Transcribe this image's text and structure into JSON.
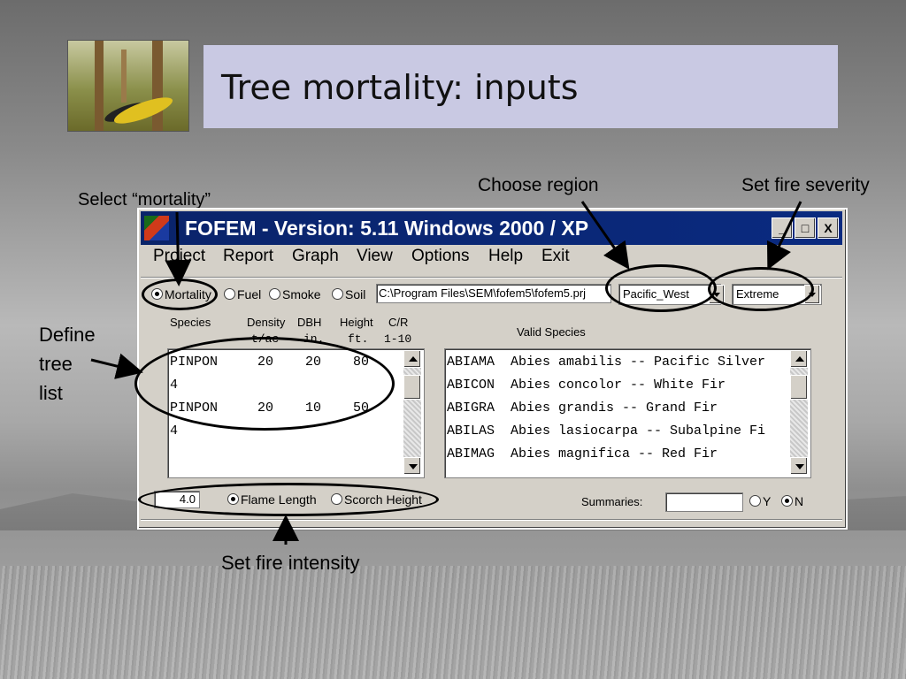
{
  "slide": {
    "title": "Tree mortality: inputs",
    "annotations": {
      "select_mortality": "Select “mortality”",
      "choose_region": "Choose region",
      "set_fire_severity": "Set fire severity",
      "define_tree_list": [
        "Define",
        "tree",
        "list"
      ],
      "set_fire_intensity": "Set fire intensity"
    }
  },
  "window": {
    "title": "FOFEM  - Version: 5.11  Windows 2000 / XP",
    "controls": {
      "minimize": "_",
      "maximize": "□",
      "close": "X"
    },
    "menu": [
      "Project",
      "Report",
      "Graph",
      "View",
      "Options",
      "Help",
      "Exit"
    ]
  },
  "mode": {
    "options": [
      "Mortality",
      "Fuel",
      "Smoke",
      "Soil"
    ],
    "selected": "Mortality",
    "project_path": "C:\\Program Files\\SEM\\fofem5\\fofem5.prj",
    "region": "Pacific_West",
    "severity": "Extreme"
  },
  "tree_list": {
    "headers": {
      "species": "Species",
      "density": "Density",
      "density_unit": "t/ac",
      "dbh": "DBH",
      "dbh_unit": "in.",
      "height": "Height",
      "height_unit": "ft.",
      "cr": "C/R",
      "cr_unit": "1-10"
    },
    "rows": [
      "PINPON     20    20    80",
      "4",
      "PINPON     20    10    50",
      "4"
    ]
  },
  "valid_species": {
    "label": "Valid Species",
    "rows": [
      "ABIAMA  Abies amabilis -- Pacific Silver",
      "ABICON  Abies concolor -- White Fir",
      "ABIGRA  Abies grandis -- Grand Fir",
      "ABILAS  Abies lasiocarpa -- Subalpine Fi",
      "ABIMAG  Abies magnifica -- Red Fir"
    ]
  },
  "intensity": {
    "value": "4.0",
    "options": [
      "Flame Length",
      "Scorch Height"
    ],
    "selected": "Flame Length"
  },
  "summaries": {
    "label": "Summaries:",
    "value": "",
    "options": [
      "Y",
      "N"
    ],
    "selected": "N"
  }
}
